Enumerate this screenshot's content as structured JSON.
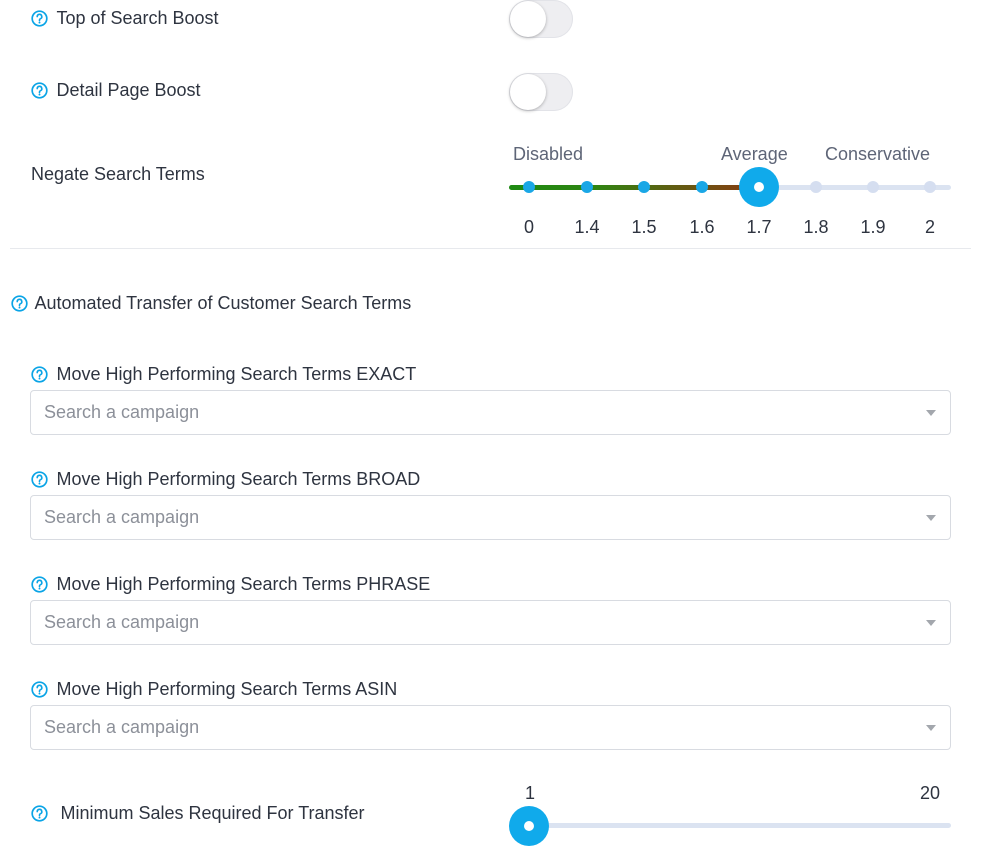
{
  "toggles": [
    {
      "label": "Top of Search Boost",
      "on": false
    },
    {
      "label": "Detail Page Boost",
      "on": false
    }
  ],
  "negate": {
    "label": "Negate Search Terms",
    "step_labels": [
      "Disabled",
      "Average",
      "Conservative"
    ],
    "ticks": [
      "0",
      "1.4",
      "1.5",
      "1.6",
      "1.7",
      "1.8",
      "1.9",
      "2"
    ],
    "value": "1.7",
    "colors": {
      "filled_start": "#1e8a12",
      "filled_end": "#8a3b12",
      "active_dot": "#1aa7e6",
      "thumb": "#10aaeb",
      "track": "#dbe3f1"
    }
  },
  "automated_transfer": {
    "title": "Automated Transfer of Customer Search Terms",
    "fields": [
      {
        "label": "Move High Performing Search Terms EXACT",
        "placeholder": "Search a campaign"
      },
      {
        "label": "Move High Performing Search Terms BROAD",
        "placeholder": "Search a campaign"
      },
      {
        "label": "Move High Performing Search Terms PHRASE",
        "placeholder": "Search a campaign"
      },
      {
        "label": "Move High Performing Search Terms ASIN",
        "placeholder": "Search a campaign"
      }
    ]
  },
  "min_sales": {
    "label": "Minimum Sales Required For Transfer",
    "min": "1",
    "max": "20",
    "value": 1
  },
  "icons": {
    "help": "question-circle-icon",
    "dropdown": "caret-down-icon"
  },
  "accent_color": "#0aa4e6"
}
